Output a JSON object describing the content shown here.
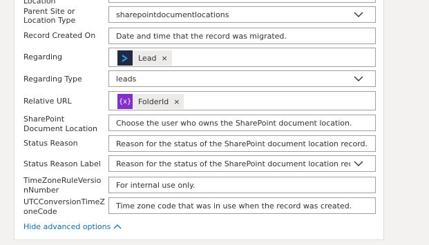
{
  "rows": {
    "location": {
      "label": "Location"
    },
    "parent_site": {
      "label_line1": "Parent Site or",
      "label_line2": "Location Type",
      "value": "sharepointdocumentlocations"
    },
    "record_created": {
      "label": "Record Created On",
      "placeholder": "Date and time that the record was migrated."
    },
    "regarding": {
      "label": "Regarding",
      "tag": "Lead",
      "tag_close": "×"
    },
    "regarding_type": {
      "label": "Regarding Type",
      "value": "leads"
    },
    "relative_url": {
      "label": "Relative URL",
      "tag": "FolderId",
      "tag_close": "×"
    },
    "sp_doc_location": {
      "label_line1": "SharePoint",
      "label_line2": "Document Location",
      "placeholder": "Choose the user who owns the SharePoint document location."
    },
    "status_reason": {
      "label": "Status Reason",
      "placeholder": "Reason for the status of the SharePoint document location record."
    },
    "status_reason_label": {
      "label": "Status Reason Label",
      "placeholder": "Reason for the status of the SharePoint document location record"
    },
    "tz_rule": {
      "label_line1": "TimeZoneRuleVersio",
      "label_line2": "nNumber",
      "placeholder": "For internal use only."
    },
    "utc_conversion": {
      "label_line1": "UTCConversionTimeZ",
      "label_line2": "oneCode",
      "placeholder": "Time zone code that was in use when the record was created."
    }
  },
  "advanced_link": {
    "label": "Hide advanced options"
  },
  "colors": {
    "lead_icon_bg": "#1f2a44",
    "lead_icon_fg": "#2d9ee8",
    "folder_icon_bg": "#8230c8",
    "link": "#0f6cbd"
  },
  "icons": {
    "lead": "dynamics-lead-icon",
    "folder": "variable-icon",
    "dropdown": "chevron-down-icon",
    "collapse": "chevron-up-icon"
  }
}
